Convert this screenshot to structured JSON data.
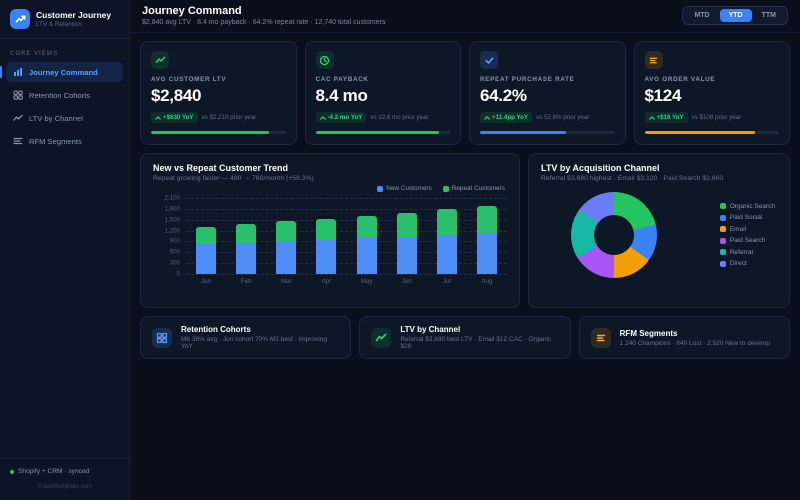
{
  "sidebar": {
    "brand": {
      "title": "Customer Journey",
      "subtitle": "LTV & Retention",
      "icon": "trend-up-icon"
    },
    "section_label": "CORE VIEWS",
    "items": [
      {
        "label": "Journey Command",
        "icon": "bar-chart-icon",
        "active": true
      },
      {
        "label": "Retention Cohorts",
        "icon": "grid-icon",
        "active": false
      },
      {
        "label": "LTV by Channel",
        "icon": "trend-line-icon",
        "active": false
      },
      {
        "label": "RFM Segments",
        "icon": "rows-icon",
        "active": false
      }
    ],
    "footer": {
      "status": "Shopify + CRM · synced",
      "copyright": "© dashtemplate.com"
    }
  },
  "header": {
    "title": "Journey Command",
    "subtitle": "$2,840 avg LTV · 8.4 mo payback · 64.2% repeat rate · 12,740 total customers",
    "range_buttons": [
      {
        "label": "MTD",
        "active": false
      },
      {
        "label": "YTD",
        "active": true
      },
      {
        "label": "TTM",
        "active": false
      }
    ]
  },
  "kpis": [
    {
      "label": "AVG CUSTOMER LTV",
      "value": "$2,840",
      "delta": "+$630 YoY",
      "compare": "vs $2,210 prior year",
      "icon": "trend-up-icon",
      "accent": "#22c55e",
      "progress_pct": 88
    },
    {
      "label": "CAC PAYBACK",
      "value": "8.4 mo",
      "delta": "-4.2 mo YoY",
      "compare": "vs 12.6 mo prior year",
      "icon": "clock-icon",
      "accent": "#22c55e",
      "progress_pct": 92
    },
    {
      "label": "REPEAT PURCHASE RATE",
      "value": "64.2%",
      "delta": "+11.4pp YoY",
      "compare": "vs 52.8% prior year",
      "icon": "check-icon",
      "accent": "#3b82f6",
      "progress_pct": 64
    },
    {
      "label": "AVG ORDER VALUE",
      "value": "$124",
      "delta": "+$16 YoY",
      "compare": "vs $108 prior year",
      "icon": "rows-icon",
      "accent": "#f59e0b",
      "progress_pct": 82
    }
  ],
  "panels": {
    "trend": {
      "title": "New vs Repeat Customer Trend",
      "subtitle": "Repeat growing faster — 480 → 760/month (+58.3%)"
    },
    "donut": {
      "title": "LTV by Acquisition Channel",
      "subtitle": "Referral $3,680 highest · Email $3,120 · Paid Search $2,860"
    }
  },
  "bottom_cards": [
    {
      "title": "Retention Cohorts",
      "subtitle": "M6 36% avg · Jun cohort 70% M1 best · improving YoY",
      "icon": "grid-icon",
      "accent": "blue"
    },
    {
      "title": "LTV by Channel",
      "subtitle": "Referral $3,680 best LTV · Email $12 CAC · Organic $28",
      "icon": "trend-up-icon",
      "accent": "green"
    },
    {
      "title": "RFM Segments",
      "subtitle": "1,240 Champions · 640 Lost · 2,520 New to develop",
      "icon": "rows-icon",
      "accent": "orange"
    }
  ],
  "chart_data": [
    {
      "type": "bar",
      "stacked": true,
      "title": "New vs Repeat Customer Trend",
      "subtitle": "Repeat growing faster — 480 → 760/month (+58.3%)",
      "categories": [
        "Jan",
        "Feb",
        "Mar",
        "Apr",
        "May",
        "Jun",
        "Jul",
        "Aug"
      ],
      "series": [
        {
          "name": "New Customers",
          "color": "#4e8cf6",
          "values": [
            820,
            860,
            910,
            950,
            990,
            1030,
            1080,
            1120
          ]
        },
        {
          "name": "Repeat Customers",
          "color": "#29c06d",
          "values": [
            480,
            510,
            550,
            580,
            620,
            660,
            710,
            760
          ]
        }
      ],
      "ylim": [
        0,
        2100
      ],
      "yticks": [
        0,
        300,
        600,
        900,
        1200,
        1500,
        1800,
        2100
      ],
      "ytick_labels_top_down": [
        "2,100",
        "1,800",
        "1,500",
        "1,200",
        "900",
        "600",
        "300",
        "0"
      ],
      "grid": "dashed-horizontal",
      "legend_position": "top-right"
    },
    {
      "type": "pie",
      "donut": true,
      "title": "LTV by Acquisition Channel",
      "segments": [
        {
          "label": "Organic Search",
          "color": "#22c55e",
          "share_pct": 21
        },
        {
          "label": "Paid Social",
          "color": "#3b82f6",
          "share_pct": 14
        },
        {
          "label": "Email",
          "color": "#f59e0b",
          "share_pct": 15
        },
        {
          "label": "Paid Search",
          "color": "#a855f7",
          "share_pct": 16
        },
        {
          "label": "Referral",
          "color": "#16b8a6",
          "share_pct": 19
        },
        {
          "label": "Direct",
          "color": "#6d7cf5",
          "share_pct": 15
        }
      ],
      "legend_position": "right"
    }
  ]
}
